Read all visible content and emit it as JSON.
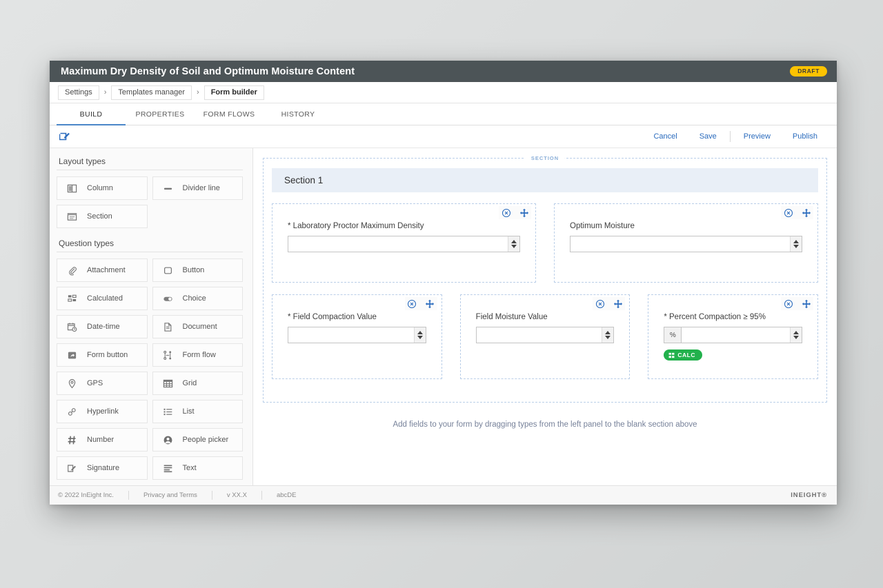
{
  "window": {
    "title": "Maximum Dry Density of Soil and Optimum Moisture Content",
    "status_badge": "DRAFT",
    "accent_color": "#2a6bbd",
    "titlebar_color": "#4c5457",
    "draft_color": "#fdc300"
  },
  "breadcrumb": {
    "items": [
      {
        "label": "Settings"
      },
      {
        "label": "Templates manager"
      },
      {
        "label": "Form builder"
      }
    ],
    "separator": "›"
  },
  "tabs": [
    {
      "label": "BUILD",
      "selected": true
    },
    {
      "label": "PROPERTIES",
      "selected": false
    },
    {
      "label": "FORM FLOWS",
      "selected": false
    },
    {
      "label": "HISTORY",
      "selected": false
    }
  ],
  "toolbar": {
    "edit_icon": "edit-pencil-square-icon",
    "cancel_label": "Cancel",
    "save_label": "Save",
    "preview_label": "Preview",
    "publish_label": "Publish"
  },
  "left_panel": {
    "layout_heading": "Layout types",
    "layout_types": [
      {
        "label": "Column",
        "icon": "column-icon"
      },
      {
        "label": "Divider line",
        "icon": "divider-line-icon"
      },
      {
        "label": "Section",
        "icon": "section-icon"
      }
    ],
    "question_heading": "Question types",
    "question_types": [
      {
        "label": "Attachment",
        "icon": "paperclip-icon"
      },
      {
        "label": "Button",
        "icon": "rounded-square-icon"
      },
      {
        "label": "Calculated",
        "icon": "calculated-grid-icon"
      },
      {
        "label": "Choice",
        "icon": "toggle-icon"
      },
      {
        "label": "Date-time",
        "icon": "calendar-clock-icon"
      },
      {
        "label": "Document",
        "icon": "document-icon"
      },
      {
        "label": "Form button",
        "icon": "form-button-arrow-icon"
      },
      {
        "label": "Form flow",
        "icon": "form-flow-icon"
      },
      {
        "label": "GPS",
        "icon": "map-pin-icon"
      },
      {
        "label": "Grid",
        "icon": "grid-table-icon"
      },
      {
        "label": "Hyperlink",
        "icon": "link-chain-icon"
      },
      {
        "label": "List",
        "icon": "bullet-list-icon"
      },
      {
        "label": "Number",
        "icon": "hash-icon"
      },
      {
        "label": "People picker",
        "icon": "person-circle-icon"
      },
      {
        "label": "Signature",
        "icon": "signature-pencil-icon"
      },
      {
        "label": "Text",
        "icon": "text-lines-icon"
      }
    ]
  },
  "canvas": {
    "section_tag": "SECTION",
    "section_title": "Section 1",
    "drop_hint": "Add fields to your form by dragging types from the left panel to the blank section above",
    "field_rows": [
      {
        "fields": [
          {
            "label": "* Laboratory Proctor Maximum Density",
            "value": "",
            "prefix": null,
            "has_spinner": true,
            "calc_badge": null,
            "remove_icon": "remove-circle-x-icon",
            "move_icon": "move-arrows-icon"
          },
          {
            "label": "Optimum Moisture",
            "value": "",
            "prefix": null,
            "has_spinner": true,
            "calc_badge": null,
            "remove_icon": "remove-circle-x-icon",
            "move_icon": "move-arrows-icon"
          }
        ]
      },
      {
        "fields": [
          {
            "label": "* Field Compaction Value",
            "value": "",
            "prefix": null,
            "has_spinner": true,
            "calc_badge": null,
            "remove_icon": "remove-circle-x-icon",
            "move_icon": "move-arrows-icon"
          },
          {
            "label": "Field Moisture Value",
            "value": "",
            "prefix": null,
            "has_spinner": true,
            "calc_badge": null,
            "remove_icon": "remove-circle-x-icon",
            "move_icon": "move-arrows-icon"
          },
          {
            "label": "* Percent Compaction ≥ 95%",
            "value": "",
            "prefix": "%",
            "has_spinner": true,
            "calc_badge": "CALC",
            "remove_icon": "remove-circle-x-icon",
            "move_icon": "move-arrows-icon"
          }
        ]
      }
    ]
  },
  "footer": {
    "copyright": "© 2022 InEight Inc.",
    "privacy": "Privacy and Terms",
    "version": "v XX.X",
    "build": "abcDE",
    "brand": "INEIGHT®"
  }
}
